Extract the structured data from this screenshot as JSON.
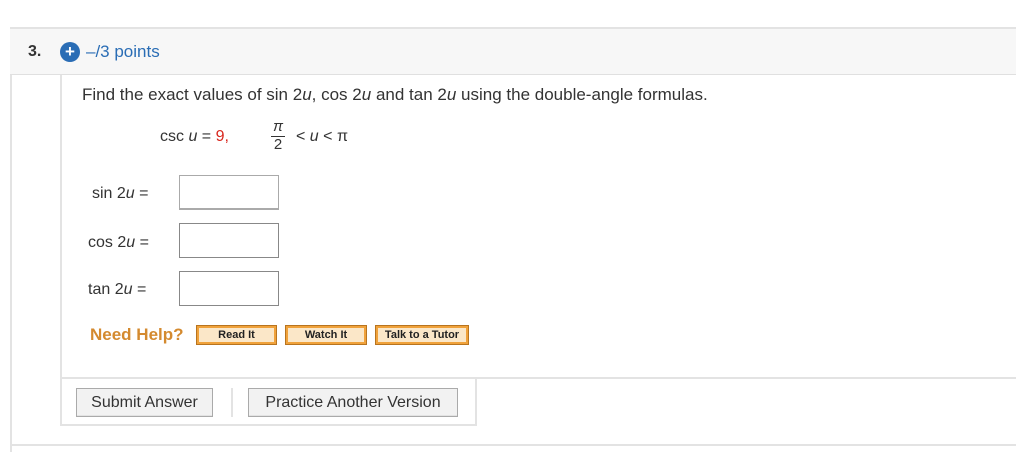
{
  "question": {
    "number": "3.",
    "points": "–/3 points",
    "prompt": {
      "part1": "Find the exact values of  sin 2",
      "var1": "u",
      "part2": ",  cos 2",
      "var2": "u",
      "part3": "  and  tan 2",
      "var3": "u",
      "part4": "  using the double-angle formulas."
    },
    "given": {
      "lhs": "csc ",
      "var": "u",
      "eq": " = ",
      "value": "9,",
      "frac_num": "π",
      "frac_den": "2",
      "ineq_lt1": " < ",
      "ineq_var": "u",
      "ineq_lt2": " < π"
    },
    "colors": {
      "accent_blue": "#2a6db5",
      "highlight_red": "#d8261d",
      "help_orange": "#d48a2f"
    }
  },
  "answers": [
    {
      "func": "sin 2",
      "var": "u",
      "eq": " =",
      "value": ""
    },
    {
      "func": "cos 2",
      "var": "u",
      "eq": " =",
      "value": ""
    },
    {
      "func": "tan 2",
      "var": "u",
      "eq": " =",
      "value": ""
    }
  ],
  "help": {
    "label": "Need Help?",
    "read": "Read It",
    "watch": "Watch It",
    "tutor": "Talk to a Tutor"
  },
  "actions": {
    "submit": "Submit Answer",
    "practice": "Practice Another Version"
  },
  "icons": {
    "expand": "plus-icon"
  }
}
